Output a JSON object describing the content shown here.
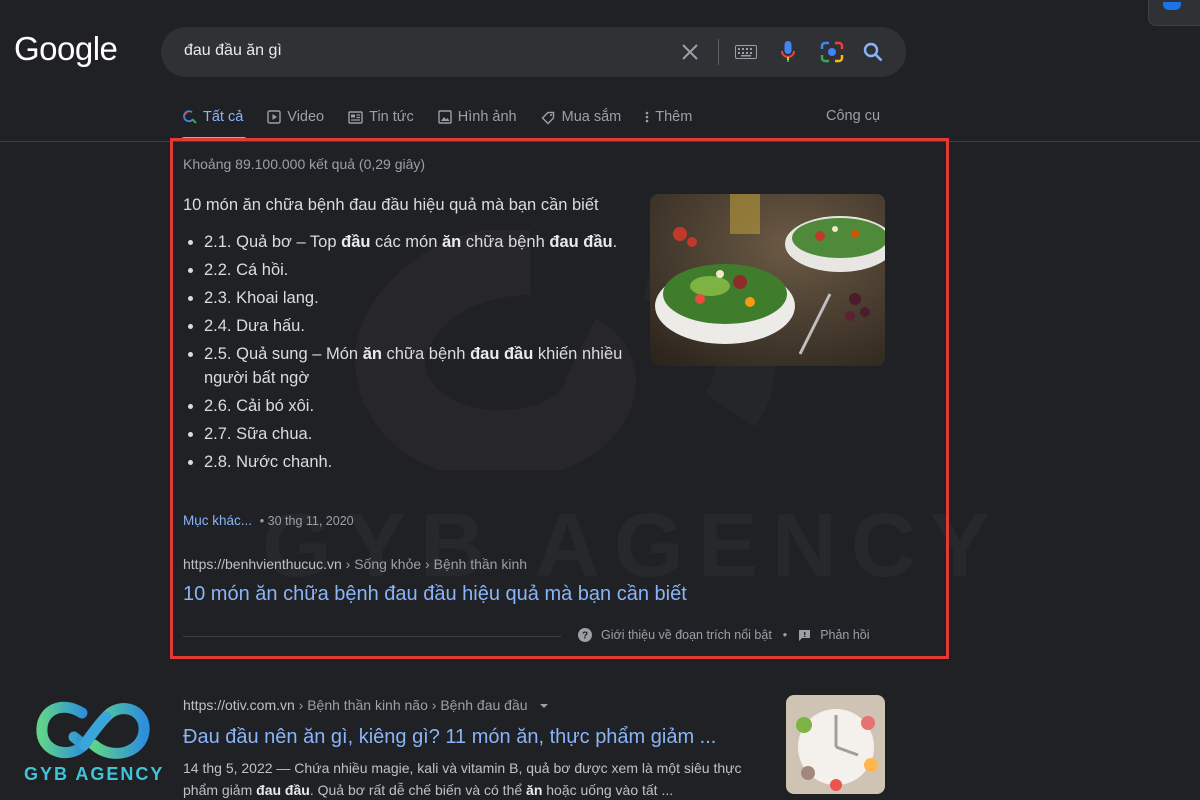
{
  "logo": "Google",
  "search": {
    "query": "đau đầu ăn gì"
  },
  "tabs": [
    {
      "label": "Tất cả",
      "icon": "search-icon"
    },
    {
      "label": "Video",
      "icon": "video-icon"
    },
    {
      "label": "Tin tức",
      "icon": "news-icon"
    },
    {
      "label": "Hình ảnh",
      "icon": "image-icon"
    },
    {
      "label": "Mua sắm",
      "icon": "tag-icon"
    },
    {
      "label": "Thêm",
      "icon": "more-vert-icon"
    }
  ],
  "tools_label": "Công cụ",
  "stats": "Khoảng 89.100.000 kết quả (0,29 giây)",
  "snippet": {
    "title": "10 món ăn chữa bệnh đau đầu hiệu quả mà bạn cần biết",
    "items": [
      {
        "pre": "2.1. Quả bơ – Top ",
        "b1": "đầu",
        "mid": " các món ",
        "b2": "ăn",
        "mid2": " chữa bệnh ",
        "b3": "đau đầu",
        "post": "."
      },
      {
        "pre": "2.2. Cá hồi."
      },
      {
        "pre": "2.3. Khoai lang."
      },
      {
        "pre": "2.4. Dưa hấu."
      },
      {
        "pre": "2.5. Quả sung – Món ",
        "b1": "ăn",
        "mid": " chữa bệnh ",
        "b2": "đau đầu",
        "mid2": " khiến nhiều người bất ngờ"
      },
      {
        "pre": "2.6. Cải bó xôi."
      },
      {
        "pre": "2.7. Sữa chua."
      },
      {
        "pre": "2.8. Nước chanh."
      }
    ],
    "more_link": "Mục khác...",
    "date": "• 30 thg 11, 2020",
    "url": "https://benhvienthucuc.vn",
    "breadcrumb": " › Sống khỏe › Bệnh thần kinh",
    "result_title": "10 món ăn chữa bệnh đau đầu hiệu quả mà bạn cần biết",
    "about_label": "Giới thiệu về đoạn trích nổi bật",
    "about_sep": "•",
    "feedback_label": "Phản hồi"
  },
  "result2": {
    "url": "https://otiv.com.vn",
    "breadcrumb": " › Bệnh thần kinh não › Bệnh đau đầu",
    "title": "Đau đầu nên ăn gì, kiêng gì? 11 món ăn, thực phẩm giảm ...",
    "desc_pre": "14 thg 5, 2022 — Chứa nhiều magie, kali và vitamin B, quả bơ được xem là một siêu thực phẩm giảm ",
    "desc_b1": "đau đầu",
    "desc_mid": ". Quả bơ rất dễ chế biến và có thể ",
    "desc_b2": "ăn",
    "desc_post": " hoặc uống vào tất ..."
  },
  "watermark": {
    "text": "GYB AGENCY"
  },
  "colors": {
    "background": "#202124",
    "link": "#8ab4f8",
    "highlight_border": "#e53935",
    "watermark_brand": "#3fc4d9"
  }
}
